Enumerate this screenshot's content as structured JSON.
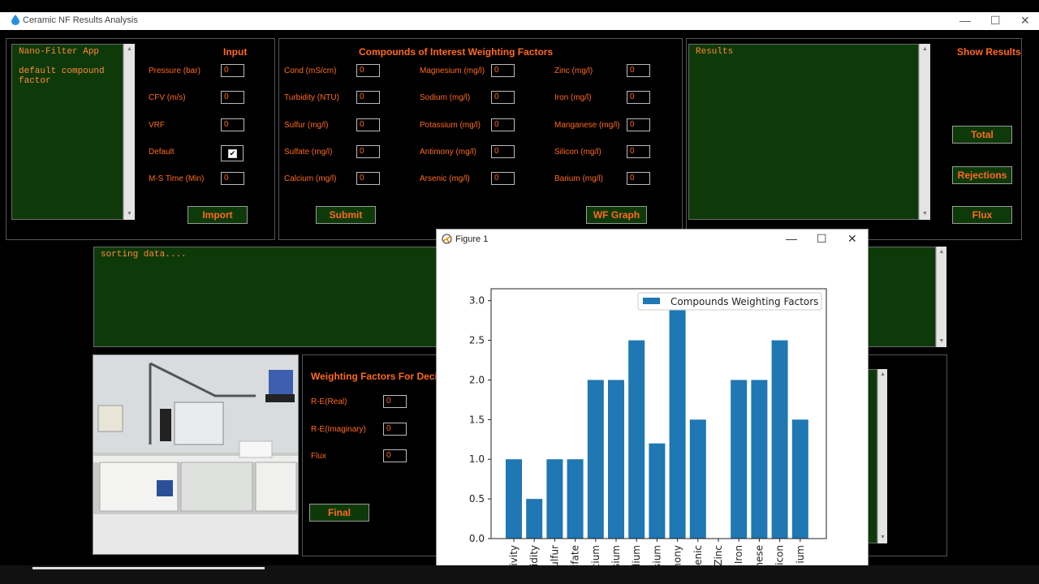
{
  "window": {
    "title": "Ceramic NF Results Analysis",
    "min": "—",
    "max": "☐",
    "close": "✕"
  },
  "left_log": {
    "text": "Nano-Filter App\n\ndefault compound\nfactor"
  },
  "input_panel": {
    "header": "Input",
    "fields": [
      {
        "label": "Pressure (bar)",
        "value": "0"
      },
      {
        "label": "CFV (m/s)",
        "value": "0"
      },
      {
        "label": "VRF",
        "value": "0"
      }
    ],
    "default_label": "Default",
    "default_checked": true,
    "ms_label": "M-S Time (Min)",
    "ms_value": "0",
    "import_button": "Import"
  },
  "compounds_panel": {
    "header": "Compounds of Interest Weighting Factors",
    "col1": [
      {
        "label": "Cond (mS/cm)",
        "value": "0"
      },
      {
        "label": "Turbidity (NTU)",
        "value": "0"
      },
      {
        "label": "Sulfur (mg/l)",
        "value": "0"
      },
      {
        "label": "Sulfate (mg/l)",
        "value": "0"
      },
      {
        "label": "Calcium (mg/l)",
        "value": "0"
      }
    ],
    "col2": [
      {
        "label": "Magnesium (mg/l)",
        "value": "0"
      },
      {
        "label": "Sodium (mg/l)",
        "value": "0"
      },
      {
        "label": "Potassium (mg/l)",
        "value": "0"
      },
      {
        "label": "Antimony (mg/l)",
        "value": "0"
      },
      {
        "label": "Arsenic (mg/l)",
        "value": "0"
      }
    ],
    "col3": [
      {
        "label": "Zinc (mg/l)",
        "value": "0"
      },
      {
        "label": "Iron (mg/l)",
        "value": "0"
      },
      {
        "label": "Manganese (mg/l)",
        "value": "0"
      },
      {
        "label": "Silicon (mg/l)",
        "value": "0"
      },
      {
        "label": "Barium (mg/l)",
        "value": "0"
      }
    ],
    "submit_button": "Submit",
    "wf_graph_button": "WF Graph"
  },
  "results_panel": {
    "text": "Results",
    "header": "Show Results",
    "total_button": "Total",
    "rejections_button": "Rejections",
    "flux_button": "Flux"
  },
  "status_log": {
    "text": "sorting data...."
  },
  "weighting_panel": {
    "header": "Weighting Factors For Decisi",
    "fields": [
      {
        "label": "R-E(Real)",
        "value": "0"
      },
      {
        "label": "R-E(Imaginary)",
        "value": "0"
      },
      {
        "label": "Flux",
        "value": "0"
      }
    ],
    "final_button": "Final"
  },
  "photo": {
    "icon": "lab-equipment-photo"
  },
  "figure": {
    "title": "Figure 1",
    "min": "—",
    "max": "☐",
    "close": "✕",
    "icon": "matplotlib-icon"
  },
  "colors": {
    "bar": "#1f77b4",
    "accent": "#ff6a1a",
    "panel_green": "#0e3a0a"
  },
  "chart_data": {
    "type": "bar",
    "categories": [
      "ivity",
      "idity",
      "ulfur",
      "lfate",
      "cium",
      "sium",
      "dium",
      "sium",
      "mony",
      "enic",
      "Zinc",
      "Iron",
      "nese",
      "icon",
      "ium"
    ],
    "series": [
      {
        "name": "Compounds Weighting  Factors",
        "values": [
          1.0,
          0.5,
          1.0,
          1.0,
          2.0,
          2.0,
          2.5,
          1.2,
          3.0,
          1.5,
          0.0,
          2.0,
          2.0,
          2.5,
          1.5
        ]
      }
    ],
    "ylim": [
      0,
      3.15
    ],
    "yticks": [
      "0.0",
      "0.5",
      "1.0",
      "1.5",
      "2.0",
      "2.5",
      "3.0"
    ],
    "legend": "top-right",
    "grid": false
  }
}
